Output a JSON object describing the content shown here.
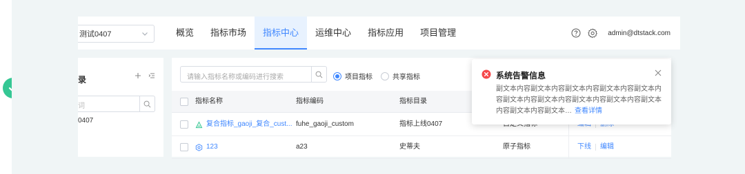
{
  "header": {
    "project_value": "测试0407",
    "nav": [
      {
        "label": "概览",
        "active": false
      },
      {
        "label": "指标市场",
        "active": false
      },
      {
        "label": "指标中心",
        "active": true
      },
      {
        "label": "运维中心",
        "active": false
      },
      {
        "label": "指标应用",
        "active": false
      },
      {
        "label": "项目管理",
        "active": false
      }
    ],
    "user": "admin@dtstack.com",
    "icons": [
      "help-icon",
      "settings-icon"
    ]
  },
  "sidebar": {
    "title": "录",
    "search_placeholder": "词",
    "tree_item": "0407"
  },
  "toolbar": {
    "search_placeholder": "请输入指标名称或编码进行搜索",
    "radios": [
      {
        "label": "项目指标",
        "checked": true
      },
      {
        "label": "共享指标",
        "checked": false
      }
    ]
  },
  "table": {
    "columns": [
      "指标名称",
      "指标编码",
      "指标目录",
      "",
      ""
    ],
    "rows": [
      {
        "name": "复合指标_gaoji_复合_cust...",
        "code": "fuhe_gaoji_custom",
        "catalog": "指标上线0407",
        "type": "自定义指标",
        "ops": [
          "编辑",
          "删除"
        ],
        "icon": "composite-metric-icon"
      },
      {
        "name": "123",
        "code": "a23",
        "catalog": "史蒂夫",
        "type": "原子指标",
        "ops": [
          "下线",
          "编辑"
        ],
        "icon": "atomic-metric-icon"
      }
    ]
  },
  "notification": {
    "title": "系统告警信息",
    "body": "副文本内容副文本内容副文本内容副文本内容副文本内容副文本内容副文本内容副文本内容副文本内容副文本内容副文本内容副文本…",
    "more": "查看详情"
  },
  "colors": {
    "primary": "#3f87ff",
    "success": "#35c794",
    "error": "#f5484b",
    "canvas": "#f0f5f6"
  }
}
